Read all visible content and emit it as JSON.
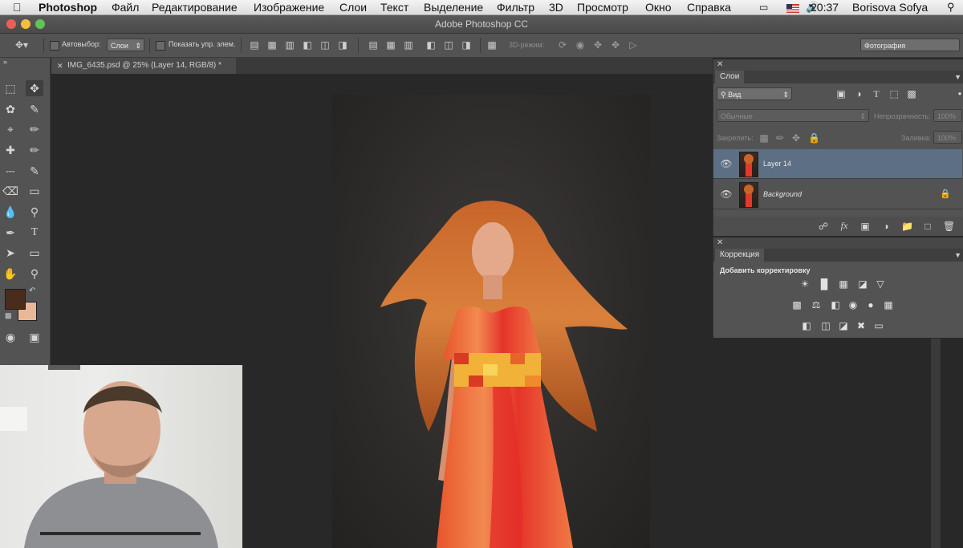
{
  "menubar": {
    "apple_icon": "apple-icon",
    "app": "Photoshop",
    "items": [
      "Файл",
      "Редактирование",
      "Изображение",
      "Слои",
      "Текст",
      "Выделение",
      "Фильтр",
      "3D",
      "Просмотр",
      "Окно",
      "Справка"
    ],
    "time": "20:37",
    "user": "Borisova Sofya"
  },
  "window": {
    "title": "Adobe Photoshop CC"
  },
  "options_bar": {
    "autoselect_label": "Автовыбор:",
    "autoselect_value": "Слои",
    "show_controls_label": "Показать упр. элем.",
    "mode3d_label": "3D-режим:",
    "workspace": "Фотография"
  },
  "document": {
    "tab_title": "IMG_6435.psd @ 25% (Layer 14, RGB/8) *"
  },
  "layers_panel": {
    "tab": "Слои",
    "filter_kind": "Вид",
    "blend_mode": "Обычные",
    "opacity_label": "Непрозрачность:",
    "opacity_value": "100%",
    "lock_label": "Закрепить:",
    "fill_label": "Заливка:",
    "fill_value": "100%",
    "layers": [
      {
        "name": "Layer 14",
        "selected": true
      },
      {
        "name": "Background",
        "selected": false,
        "locked": true
      }
    ]
  },
  "correction_panel": {
    "tab": "Коррекция",
    "header": "Добавить корректировку"
  },
  "colors": {
    "foreground": "#4a2c1c",
    "background": "#e8b898",
    "selected_layer": "#5d6f85"
  }
}
